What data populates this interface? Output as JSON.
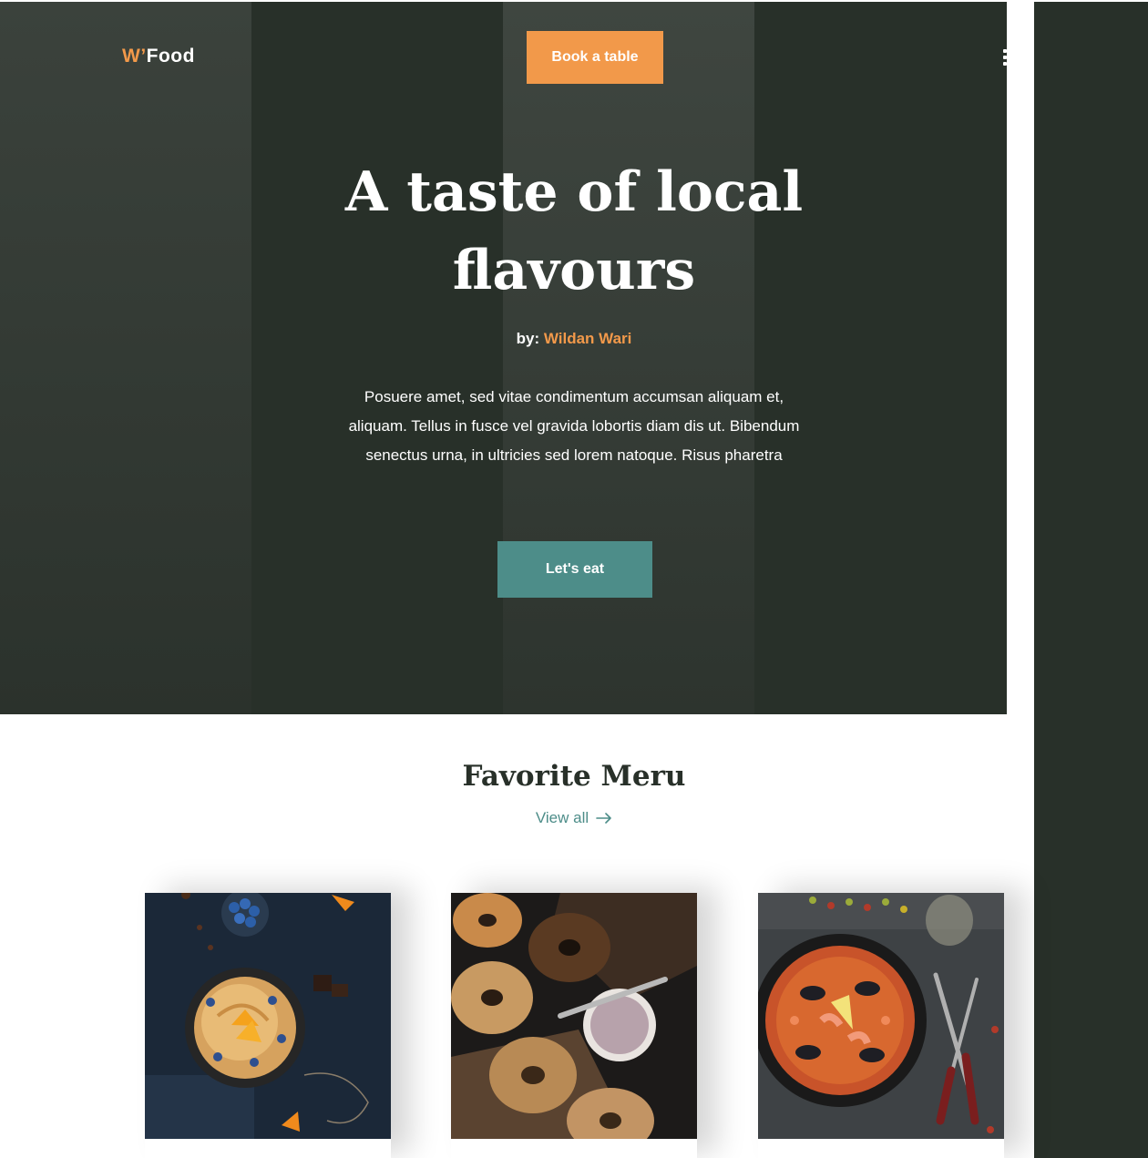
{
  "brand": {
    "logo_w": "W’",
    "logo_rest": "Food"
  },
  "header": {
    "book_button": "Book a table"
  },
  "hero": {
    "title": "A taste of local flavours",
    "by_label": "by:",
    "author": "Wildan Wari",
    "description": "Posuere amet, sed vitae condimentum accumsan aliquam et, aliquam. Tellus in fusce vel gravida lobortis diam dis ut. Bibendum senectus urna, in ultricies sed lorem natoque. Risus pharetra",
    "cta": "Let's eat"
  },
  "menu_section": {
    "title": "Favorite Meru",
    "view_all": "View all"
  },
  "cards": [
    {
      "image": "pancakes-with-blueberries-and-orange"
    },
    {
      "image": "bagels-with-cream-cheese"
    },
    {
      "image": "seafood-paella"
    }
  ],
  "colors": {
    "accent_orange": "#f2994a",
    "accent_teal": "#4d8d89",
    "dark_green": "#283029"
  }
}
